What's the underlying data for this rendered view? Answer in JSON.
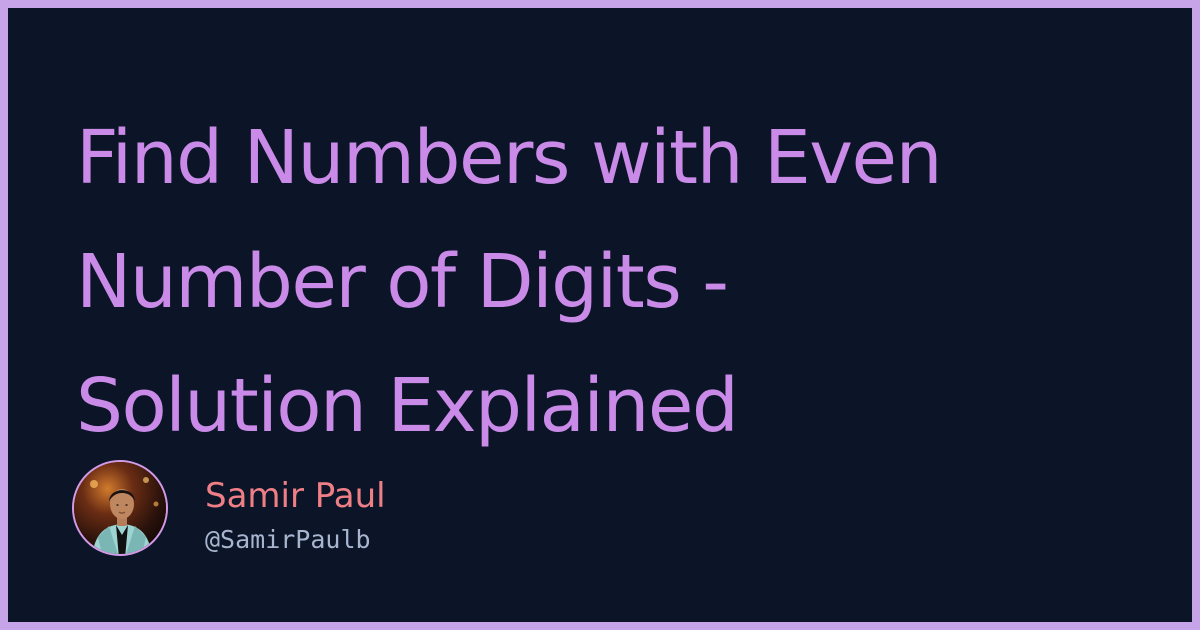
{
  "post": {
    "title_lines": [
      "Find Numbers with Even",
      "Number of Digits -",
      "Solution Explained"
    ]
  },
  "author": {
    "name": "Samir Paul",
    "handle": "@SamirPaulb"
  },
  "colors": {
    "frame": "#c7a4e8",
    "background": "#0c1527",
    "title": "#c98ae8",
    "author_name": "#ef7f86",
    "handle": "#a8b5cf"
  },
  "icons": {
    "avatar": "author-avatar"
  }
}
